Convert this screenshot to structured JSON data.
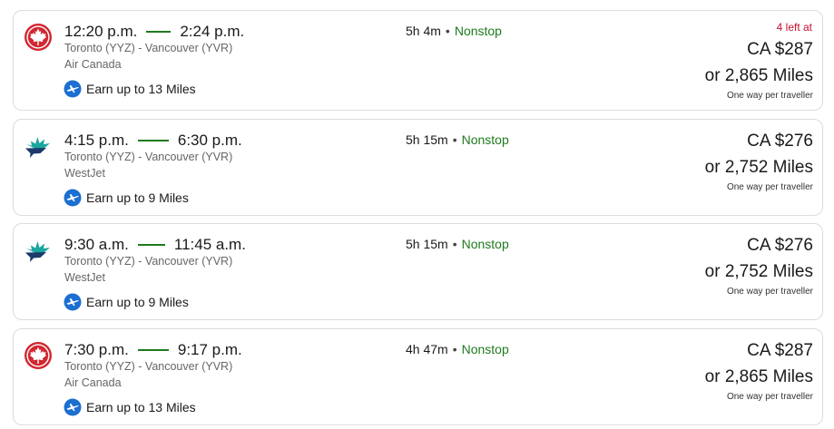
{
  "colors": {
    "nonstop": "#1f7a1f",
    "alert": "#c8102e",
    "aircanada_red": "#d22630",
    "westjet_teal": "#1aa6a0",
    "westjet_navy": "#1b3a6b",
    "aeroplan_blue": "#1c6fd1"
  },
  "flights": [
    {
      "airline_icon": "air-canada-maple-leaf-icon",
      "depart": "12:20 p.m.",
      "arrive": "2:24 p.m.",
      "route": "Toronto (YYZ) - Vancouver (YVR)",
      "airline": "Air Canada",
      "earn": "Earn up to 13 Miles",
      "duration": "5h 4m",
      "stops": "Nonstop",
      "alert": "4 left at",
      "price": "CA $287",
      "miles": "or 2,865 Miles",
      "per": "One way per traveller"
    },
    {
      "airline_icon": "westjet-icon",
      "depart": "4:15 p.m.",
      "arrive": "6:30 p.m.",
      "route": "Toronto (YYZ) - Vancouver (YVR)",
      "airline": "WestJet",
      "earn": "Earn up to 9 Miles",
      "duration": "5h 15m",
      "stops": "Nonstop",
      "alert": "",
      "price": "CA $276",
      "miles": "or 2,752 Miles",
      "per": "One way per traveller"
    },
    {
      "airline_icon": "westjet-icon",
      "depart": "9:30 a.m.",
      "arrive": "11:45 a.m.",
      "route": "Toronto (YYZ) - Vancouver (YVR)",
      "airline": "WestJet",
      "earn": "Earn up to 9 Miles",
      "duration": "5h 15m",
      "stops": "Nonstop",
      "alert": "",
      "price": "CA $276",
      "miles": "or 2,752 Miles",
      "per": "One way per traveller"
    },
    {
      "airline_icon": "air-canada-maple-leaf-icon",
      "depart": "7:30 p.m.",
      "arrive": "9:17 p.m.",
      "route": "Toronto (YYZ) - Vancouver (YVR)",
      "airline": "Air Canada",
      "earn": "Earn up to 13 Miles",
      "duration": "4h 47m",
      "stops": "Nonstop",
      "alert": "",
      "price": "CA $287",
      "miles": "or 2,865 Miles",
      "per": "One way per traveller"
    }
  ]
}
